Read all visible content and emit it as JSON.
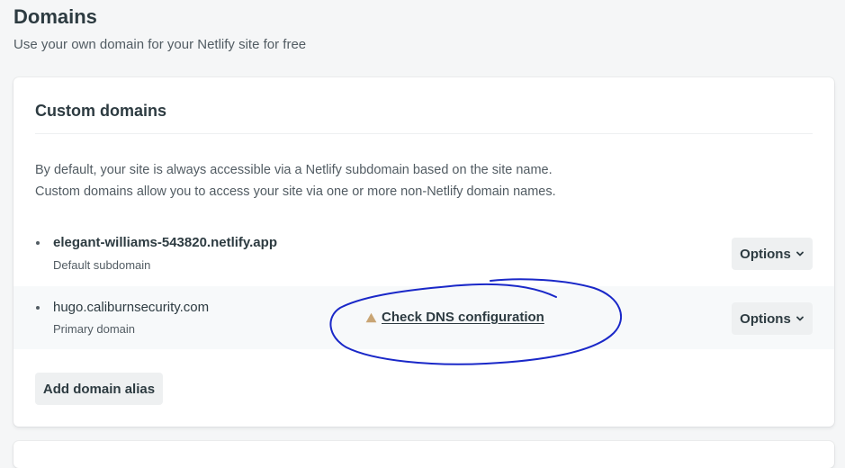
{
  "header": {
    "title": "Domains",
    "subtitle": "Use your own domain for your Netlify site for free"
  },
  "custom_domains": {
    "title": "Custom domains",
    "description_line_1": "By default, your site is always accessible via a Netlify subdomain based on the site name.",
    "description_line_2": "Custom domains allow you to access your site via one or more non-Netlify domain names.",
    "domains": [
      {
        "name": "elegant-williams-543820.netlify.app",
        "role": "Default subdomain",
        "options_label": "Options"
      },
      {
        "name": "hugo.caliburnsecurity.com",
        "role": "Primary domain",
        "dns_link_label": "Check DNS configuration",
        "options_label": "Options"
      }
    ],
    "add_alias_label": "Add domain alias"
  },
  "colors": {
    "text_primary": "#2d3b41",
    "text_secondary": "#525c63",
    "button_bg": "#eef0f1",
    "warning_icon": "#c9a574",
    "annotation_ink": "#1a28c8"
  },
  "icons": {
    "chevron": "chevron-down-icon",
    "warning": "warning-icon",
    "bullet": "bullet-icon"
  }
}
